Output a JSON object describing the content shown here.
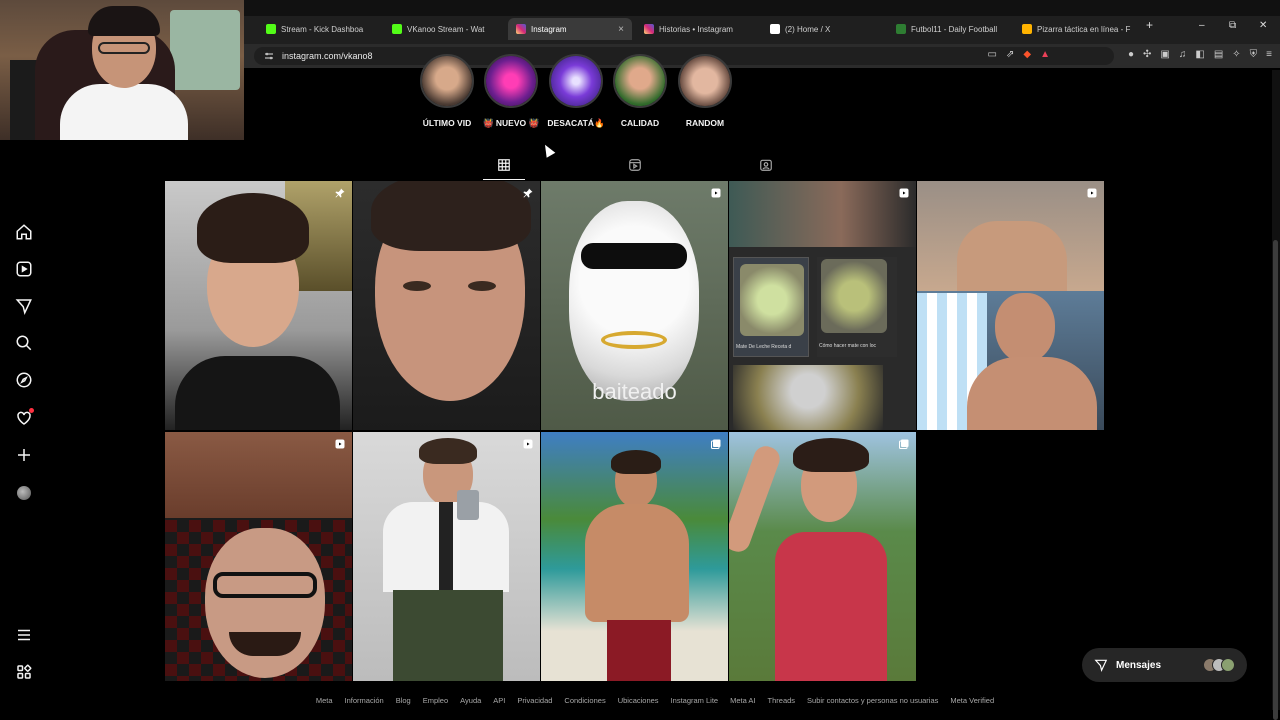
{
  "browser": {
    "tabs": [
      {
        "label": "Stream - Kick Dashboa",
        "color": "#53fc18",
        "active": false
      },
      {
        "label": "VKanoo Stream - Wat",
        "color": "#53fc18",
        "active": false
      },
      {
        "label": "Instagram",
        "color": "#e1306c",
        "active": true
      },
      {
        "label": "Historias • Instagram",
        "color": "#e1306c",
        "active": false
      },
      {
        "label": "(2) Home / X",
        "color": "#ffffff",
        "active": false
      },
      {
        "label": "Futbol11 - Daily Football",
        "color": "#2e7d32",
        "active": false
      },
      {
        "label": "Pizarra táctica en línea - F",
        "color": "#ffb300",
        "active": false
      }
    ],
    "close_glyph": "×",
    "new_tab_glyph": "+",
    "window_controls": [
      "–",
      "⧉",
      "✕"
    ],
    "url": "instagram.com/vkano8"
  },
  "highlights": [
    {
      "label": "ÚLTIMO VID"
    },
    {
      "label": "👹 NUEVO 👹"
    },
    {
      "label": "DESACATÁ🔥"
    },
    {
      "label": "CALIDAD"
    },
    {
      "label": "RANDOM"
    }
  ],
  "profile_tabs": [
    "grid-icon",
    "reels-icon",
    "tagged-icon"
  ],
  "posts": [
    {
      "type": "pinned",
      "caption": ""
    },
    {
      "type": "pinned",
      "caption": ""
    },
    {
      "type": "reel",
      "caption": "baiteado"
    },
    {
      "type": "reel",
      "caption": "",
      "screenshot_titles": [
        "Mate De Leche Receta d",
        "Cómo hacer mate con loc"
      ]
    },
    {
      "type": "reel",
      "caption": ""
    },
    {
      "type": "reel",
      "caption": ""
    },
    {
      "type": "reel",
      "caption": ""
    },
    {
      "type": "carousel",
      "caption": ""
    },
    {
      "type": "carousel",
      "caption": ""
    }
  ],
  "footer_links": [
    "Meta",
    "Información",
    "Blog",
    "Empleo",
    "Ayuda",
    "API",
    "Privacidad",
    "Condiciones",
    "Ubicaciones",
    "Instagram Lite",
    "Meta AI",
    "Threads",
    "Subir contactos y personas no usuarias",
    "Meta Verified"
  ],
  "messages": {
    "label": "Mensajes"
  },
  "colors": {
    "accent": "#ff3040",
    "bg": "#000000"
  }
}
